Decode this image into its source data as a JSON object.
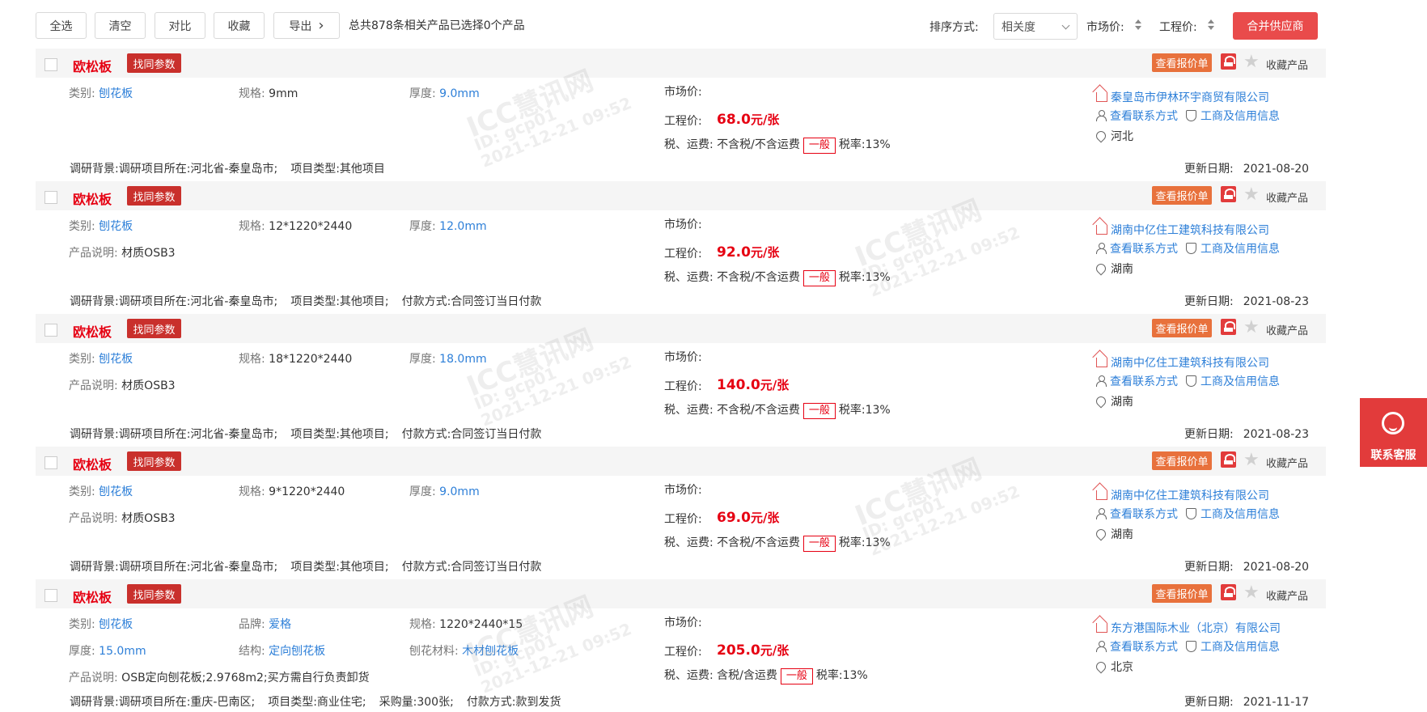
{
  "toolbar": {
    "buttons": [
      "全选",
      "清空",
      "对比",
      "收藏",
      "导出"
    ],
    "export_chevron": "›",
    "summary": "总共878条相关产品已选择0个产品",
    "sort_label": "排序方式:",
    "sort_value": "相关度",
    "market_price_sort": "市场价:",
    "engineering_price_sort": "工程价:",
    "merge_button": "合并供应商"
  },
  "labels": {
    "same_params": "找同参数",
    "view_quote": "查看报价单",
    "fav_product": "收藏产品",
    "category": "类别:",
    "spec": "规格:",
    "thickness": "厚度:",
    "brand": "品牌:",
    "structure": "结构:",
    "particle_material": "刨花材料:",
    "product_desc": "产品说明:",
    "market_price": "市场价:",
    "engineering_price": "工程价:",
    "tax_freight": "税、运费:",
    "general_tag": "一般",
    "view_contact": "查看联系方式",
    "credit_info": "工商及信用信息",
    "research_bg": "调研背景:",
    "update_date": "更新日期:"
  },
  "products": [
    {
      "title": "欧松板",
      "category": "刨花板",
      "spec": "9mm",
      "thickness": "9.0mm",
      "desc": "",
      "price": "68.0",
      "price_unit": "元/张",
      "tax_text": "不含税/不含运费",
      "tax_rate": "税率:13%",
      "supplier": "秦皇岛市伊林环宇商贸有限公司",
      "region": "河北",
      "background": [
        "调研项目所在:河北省-秦皇岛市;",
        "项目类型:其他项目"
      ],
      "date": "2021-08-20"
    },
    {
      "title": "欧松板",
      "category": "刨花板",
      "spec": "12*1220*2440",
      "thickness": "12.0mm",
      "desc": "材质OSB3",
      "price": "92.0",
      "price_unit": "元/张",
      "tax_text": "不含税/不含运费",
      "tax_rate": "税率:13%",
      "supplier": "湖南中亿住工建筑科技有限公司",
      "region": "湖南",
      "background": [
        "调研项目所在:河北省-秦皇岛市;",
        "项目类型:其他项目;",
        "付款方式:合同签订当日付款"
      ],
      "date": "2021-08-23"
    },
    {
      "title": "欧松板",
      "category": "刨花板",
      "spec": "18*1220*2440",
      "thickness": "18.0mm",
      "desc": "材质OSB3",
      "price": "140.0",
      "price_unit": "元/张",
      "tax_text": "不含税/不含运费",
      "tax_rate": "税率:13%",
      "supplier": "湖南中亿住工建筑科技有限公司",
      "region": "湖南",
      "background": [
        "调研项目所在:河北省-秦皇岛市;",
        "项目类型:其他项目;",
        "付款方式:合同签订当日付款"
      ],
      "date": "2021-08-23"
    },
    {
      "title": "欧松板",
      "category": "刨花板",
      "spec": "9*1220*2440",
      "thickness": "9.0mm",
      "desc": "材质OSB3",
      "price": "69.0",
      "price_unit": "元/张",
      "tax_text": "不含税/不含运费",
      "tax_rate": "税率:13%",
      "supplier": "湖南中亿住工建筑科技有限公司",
      "region": "湖南",
      "background": [
        "调研项目所在:河北省-秦皇岛市;",
        "项目类型:其他项目;",
        "付款方式:合同签订当日付款"
      ],
      "date": "2021-08-20"
    },
    {
      "title": "欧松板",
      "category": "刨花板",
      "brand": "爱格",
      "spec": "1220*2440*15",
      "thickness": "15.0mm",
      "structure": "定向刨花板",
      "particle_material": "木材刨花板",
      "desc": "OSB定向刨花板;2.9768m2;买方需自行负责卸货",
      "price": "205.0",
      "price_unit": "元/张",
      "tax_text": "含税/含运费",
      "tax_rate": "税率:13%",
      "supplier": "东方港国际木业（北京）有限公司",
      "region": "北京",
      "background": [
        "调研项目所在:重庆-巴南区;",
        "项目类型:商业住宅;",
        "采购量:300张;",
        "付款方式:款到发货"
      ],
      "date": "2021-11-17"
    }
  ],
  "watermark": {
    "logo": "ICC",
    "logo_suffix": "慧讯网",
    "user": "ID: gcp01",
    "time": "2021-12-21 09:52"
  },
  "float_service": {
    "label": "联系客服"
  },
  "colors": {
    "brand_red": "#e60012",
    "link_blue": "#2d7fd8",
    "quote_orange": "#e8713c"
  }
}
